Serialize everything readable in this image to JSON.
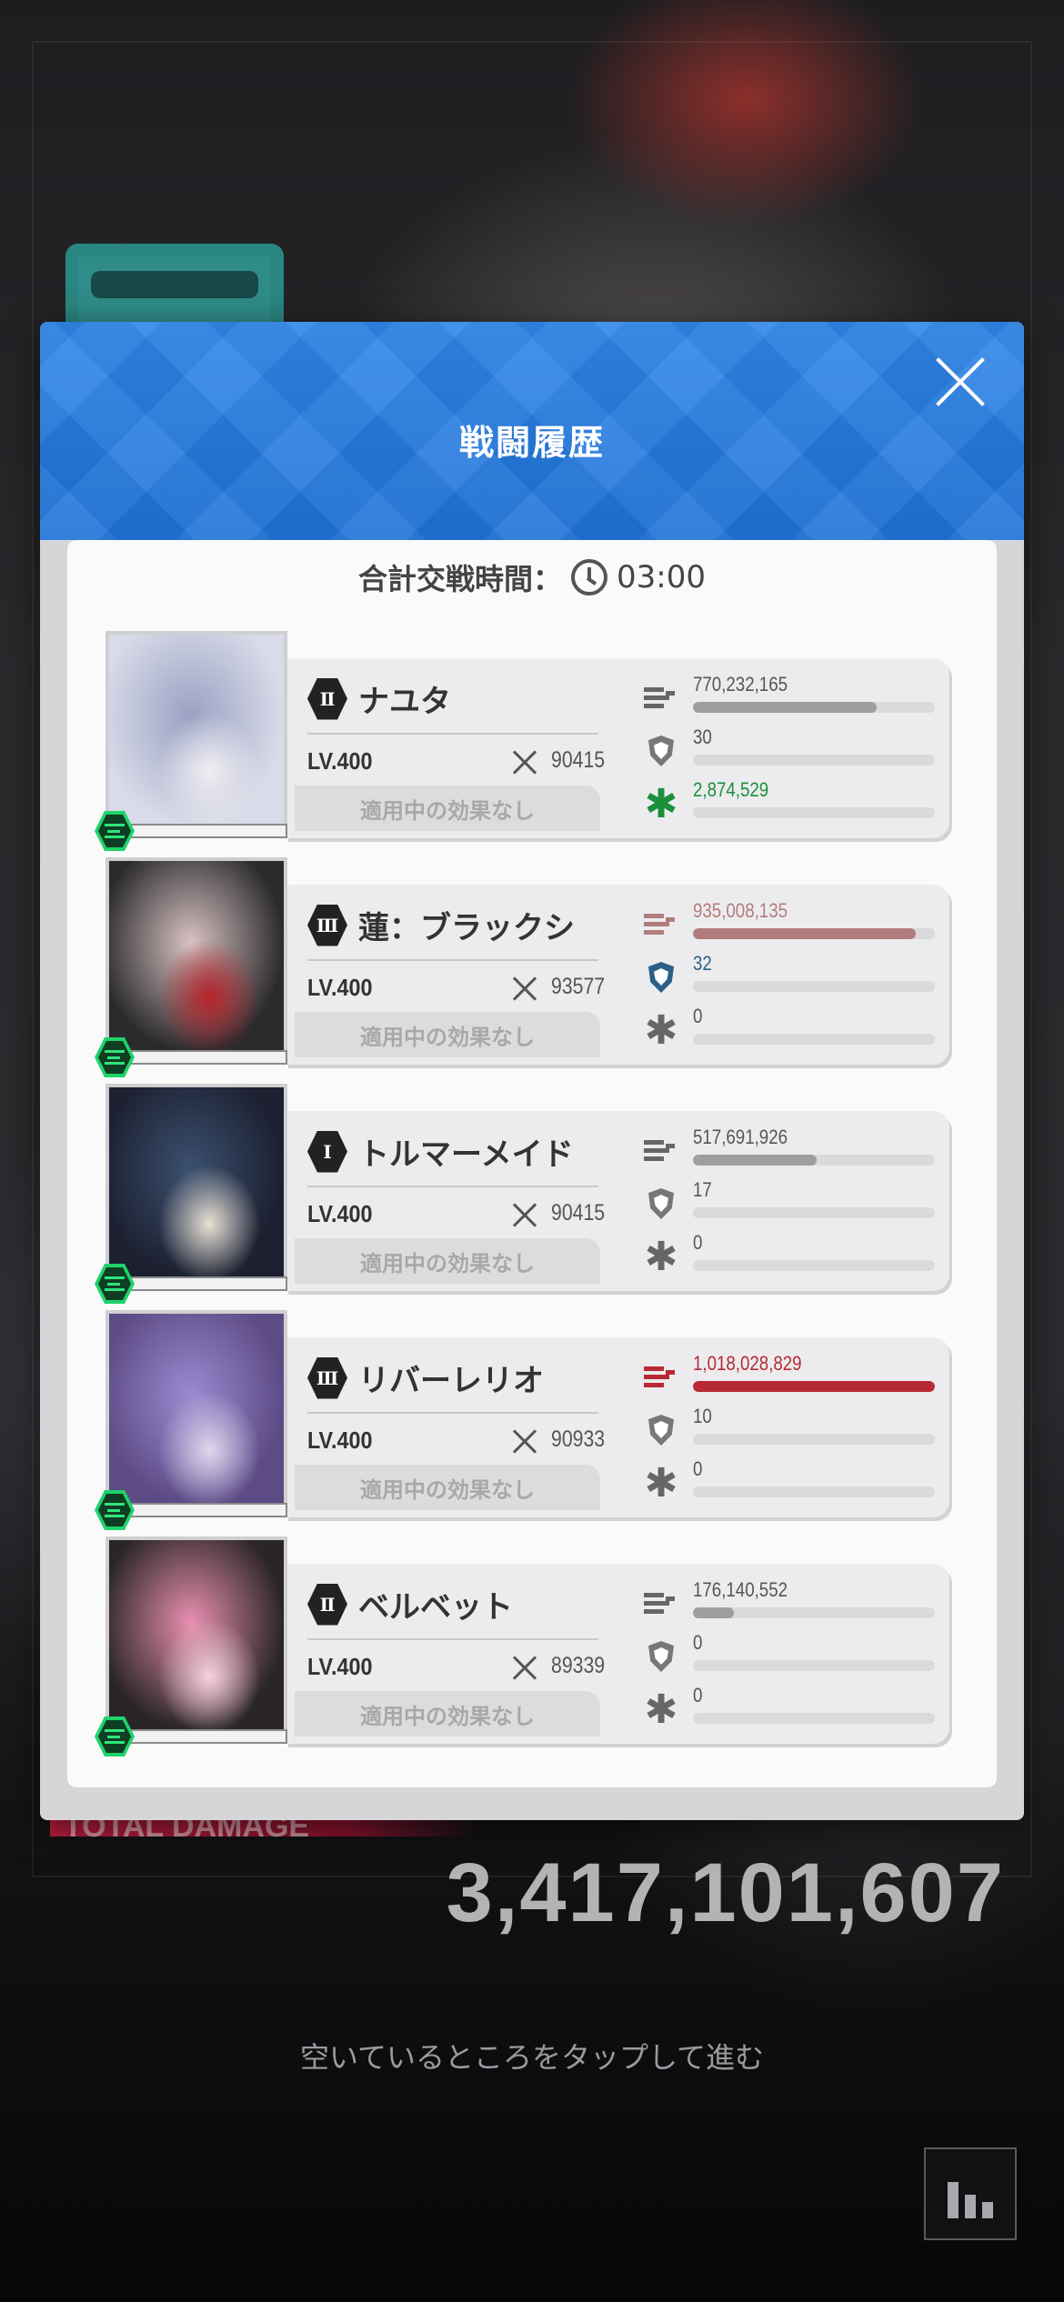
{
  "modal": {
    "title": "戦闘履歴",
    "time_label": "合計交戦時間：",
    "time_value": "03:00"
  },
  "effect_text": "適用中の効果なし",
  "units": [
    {
      "grade": "Ⅱ",
      "name": "ナユタ",
      "level": "LV.400",
      "power": "90415",
      "damage": "770,232,165",
      "damage_ratio": 0.76,
      "damage_color": "#9e9ea0",
      "shield": "30",
      "shield_ratio": 0.0,
      "shield_color": "#777777",
      "heal": "2,874,529",
      "heal_ratio": 0.0,
      "heal_color": "#1b8f3a",
      "portrait": [
        "#d9dbe8",
        "#9aa2c4",
        "#f0eef2"
      ]
    },
    {
      "grade": "Ⅲ",
      "name": "蓮：ブラックシ",
      "level": "LV.400",
      "power": "93577",
      "damage": "935,008,135",
      "damage_ratio": 0.92,
      "damage_color": "#b37c7c",
      "shield": "32",
      "shield_ratio": 0.0,
      "shield_color": "#2b5f86",
      "heal": "0",
      "heal_ratio": 0.0,
      "heal_color": "#666666",
      "portrait": [
        "#2b2b2e",
        "#d9c3c3",
        "#b5242b"
      ]
    },
    {
      "grade": "Ⅰ",
      "name": "トルマーメイド",
      "level": "LV.400",
      "power": "90415",
      "damage": "517,691,926",
      "damage_ratio": 0.51,
      "damage_color": "#9e9ea0",
      "shield": "17",
      "shield_ratio": 0.0,
      "shield_color": "#777777",
      "heal": "0",
      "heal_ratio": 0.0,
      "heal_color": "#666666",
      "portrait": [
        "#1c2030",
        "#3b5070",
        "#e8e0d4"
      ]
    },
    {
      "grade": "Ⅲ",
      "name": "リバーレリオ",
      "level": "LV.400",
      "power": "90933",
      "damage": "1,018,028,829",
      "damage_ratio": 1.0,
      "damage_color": "#b72a33",
      "shield": "10",
      "shield_ratio": 0.0,
      "shield_color": "#777777",
      "heal": "0",
      "heal_ratio": 0.0,
      "heal_color": "#666666",
      "portrait": [
        "#5d4b86",
        "#9b8ad0",
        "#e0d8ef"
      ]
    },
    {
      "grade": "Ⅱ",
      "name": "ベルベット",
      "level": "LV.400",
      "power": "89339",
      "damage": "176,140,552",
      "damage_ratio": 0.17,
      "damage_color": "#9e9ea0",
      "shield": "0",
      "shield_ratio": 0.0,
      "shield_color": "#777777",
      "heal": "0",
      "heal_ratio": 0.0,
      "heal_color": "#666666",
      "portrait": [
        "#2a2528",
        "#e88fb0",
        "#f7d2dd"
      ]
    }
  ],
  "footer": {
    "total_label": "TOTAL DAMAGE",
    "total_value": "3,417,101,607",
    "tap_hint": "空いているところをタップして進む"
  },
  "icons": [
    "close-icon",
    "clock-icon",
    "swords-icon",
    "damage-icon",
    "shield-icon",
    "heal-icon",
    "burst-wind-icon",
    "stats-chart-icon"
  ]
}
